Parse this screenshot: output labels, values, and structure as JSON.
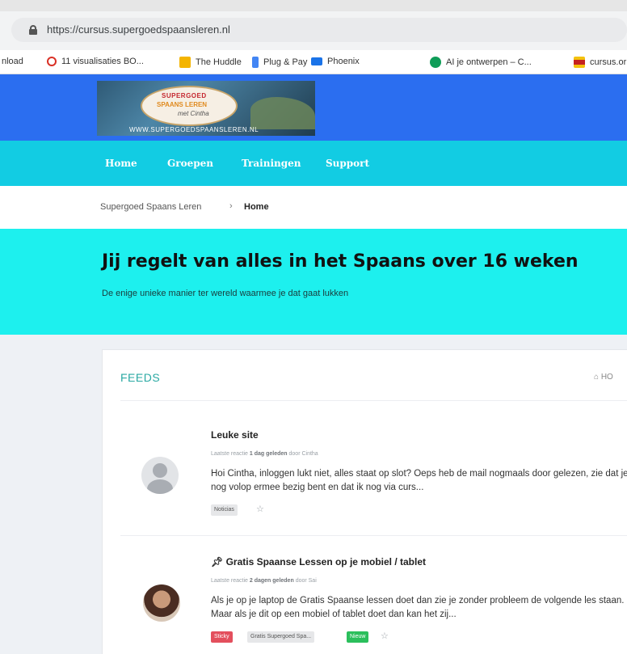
{
  "browser": {
    "url": "https://cursus.supergoedspaansleren.nl",
    "bookmarks": [
      {
        "label": "nload",
        "color": ""
      },
      {
        "label": "11 visualisaties BO...",
        "color": "#d93025"
      },
      {
        "label": "The Huddle",
        "color": "#f4b400"
      },
      {
        "label": "Plug & Pay",
        "color": "#4285f4"
      },
      {
        "label": "Phoenix",
        "color": "#1a73e8"
      },
      {
        "label": "AI je ontwerpen – C...",
        "color": "#0f9d58"
      },
      {
        "label": "cursus.or",
        "color": "#c5221f"
      }
    ]
  },
  "logo": {
    "line1": "SUPERGOED",
    "line2": "SPAANS LEREN",
    "line3": "met Cintha",
    "url": "WWW.SUPERGOEDSPAANSLEREN.NL"
  },
  "nav": {
    "items": [
      "Home",
      "Groepen",
      "Trainingen",
      "Support"
    ]
  },
  "breadcrumb": {
    "parent": "Supergoed Spaans Leren",
    "separator": "›",
    "current": "Home"
  },
  "hero": {
    "title": "Jij regelt van alles in het Spaans over 16 weken",
    "subtitle": "De enige unieke manier ter wereld waarmee je dat gaat lukken"
  },
  "feeds": {
    "title": "FEEDS",
    "right_label": "⌂ HO",
    "posts": [
      {
        "title": "Leuke site",
        "meta_prefix": "Laatste reactie",
        "meta_time": "1 dag geleden",
        "meta_suffix": "door Cintha",
        "excerpt": "Hoi Cintha,  inloggen lukt niet, alles staat op slot? Oeps heb de mail nogmaals door gelezen, zie dat je nog volop ermee bezig bent en dat ik nog via curs...",
        "tags": [
          "Noticias"
        ]
      },
      {
        "title": "Gratis Spaanse Lessen op je mobiel / tablet",
        "meta_prefix": "Laatste reactie",
        "meta_time": "2 dagen geleden",
        "meta_suffix": "door Sai",
        "excerpt": "Als je op je laptop de Gratis Spaanse lessen doet dan zie je zonder probleem de volgende les staan. Maar als je dit op een mobiel of tablet doet dan kan het zij...",
        "tags": [
          "Sticky",
          "Gratis Supergoed Spa...",
          "Nieuw"
        ]
      }
    ]
  }
}
